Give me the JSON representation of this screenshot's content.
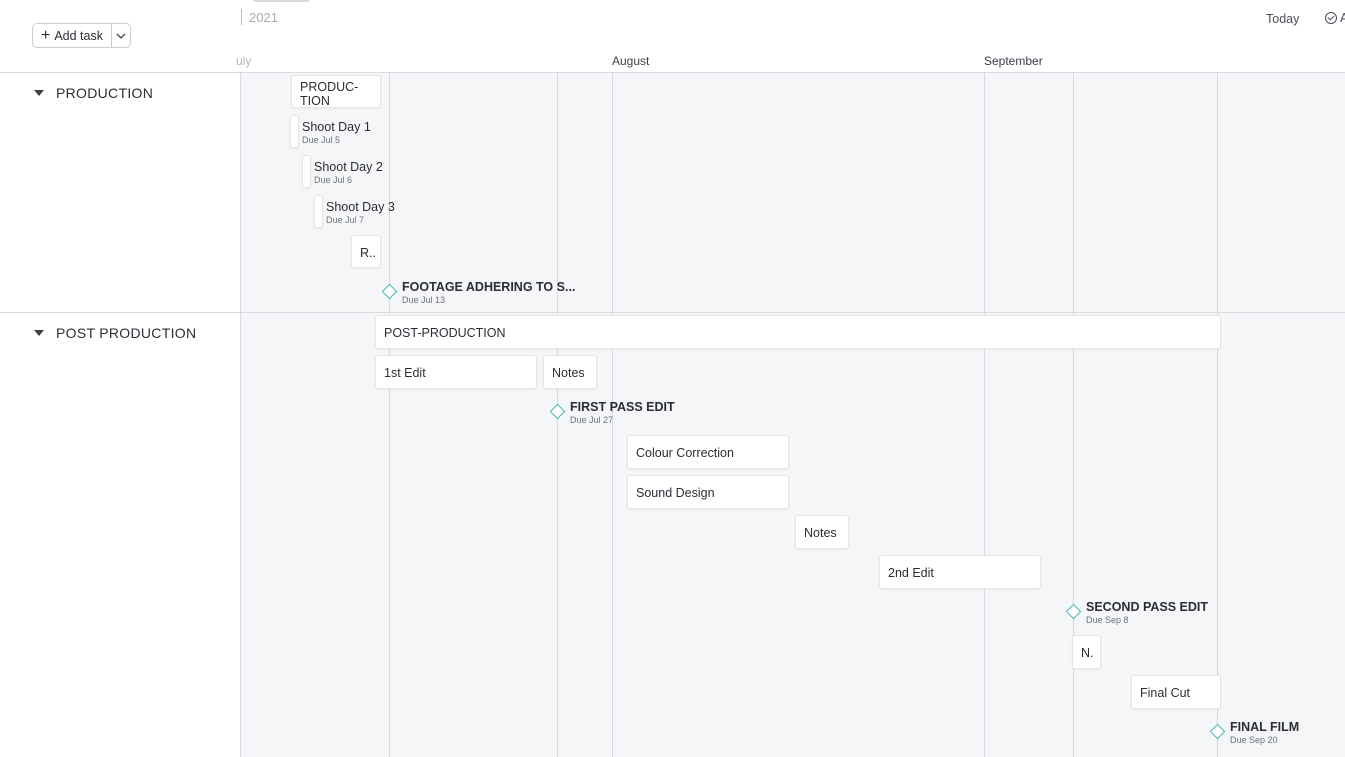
{
  "toolbar": {
    "add_task_label": "Add task",
    "add_task_plus": "+",
    "year": "2021",
    "today_label": "Today",
    "after_check_label": "A"
  },
  "months": [
    "uly",
    "August",
    "September"
  ],
  "groups": {
    "production": "PRODUCTION",
    "post_production": "POST PRODUCTION"
  },
  "production_tasks": {
    "summary_line1": "PRODUC-",
    "summary_line2": "TION",
    "shoot1": {
      "name": "Shoot Day 1",
      "due": "Due Jul 5"
    },
    "shoot2": {
      "name": "Shoot Day 2",
      "due": "Due Jul 6"
    },
    "shoot3": {
      "name": "Shoot Day 3",
      "due": "Due Jul 7"
    },
    "r_task": "R..",
    "milestone": {
      "name": "FOOTAGE ADHERING TO S...",
      "due": "Due Jul 13"
    }
  },
  "post_tasks": {
    "summary": "POST-PRODUCTION",
    "first_edit": "1st Edit",
    "notes1": "Notes",
    "ms_first": {
      "name": "FIRST PASS EDIT",
      "due": "Due Jul 27"
    },
    "colour": "Colour Correction",
    "sound": "Sound Design",
    "notes2": "Notes",
    "second_edit": "2nd Edit",
    "ms_second": {
      "name": "SECOND PASS EDIT",
      "due": "Due Sep 8"
    },
    "n_task": "N.",
    "final_cut": "Final Cut",
    "ms_final": {
      "name": "FINAL FILM",
      "due": "Due Sep 20"
    }
  },
  "colors": {
    "milestone_accent": "#3fb8b0",
    "timeline_bg": "#f5f6f7"
  }
}
